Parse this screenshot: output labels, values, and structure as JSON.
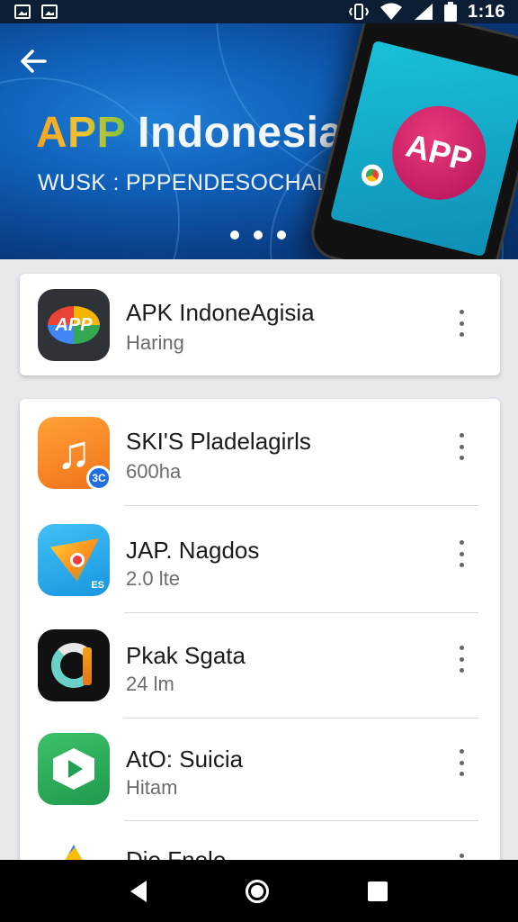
{
  "status_bar": {
    "time": "1:16",
    "left_icons": [
      "image-icon",
      "image-icon"
    ],
    "right_icons": [
      "vibrate-icon",
      "wifi-icon",
      "signal-icon",
      "battery-icon"
    ]
  },
  "hero": {
    "title_accent": "APP",
    "title_rest": " Indonesia",
    "subtitle": "WUSK : PPPENDESOCHAL",
    "phone_badge": "APP",
    "carousel_dots": 3,
    "colors": {
      "background": "#0f5fb8",
      "badge": "#d42168"
    }
  },
  "featured": {
    "name": "APK IndoneAgisia",
    "meta": "Haring"
  },
  "apps": [
    {
      "name": "SKI'S Pladelagirls",
      "meta": "600ha",
      "icon": "music-note-icon",
      "badge": "3C"
    },
    {
      "name": "JAP. Nagdos",
      "meta": "2.0 lte",
      "icon": "paper-plane-icon",
      "badge": "ES"
    },
    {
      "name": "Pkak Sgata",
      "meta": "24 lm",
      "icon": "c-letter-icon"
    },
    {
      "name": "AtO: Suicia",
      "meta": "Hitam",
      "icon": "play-icon"
    },
    {
      "name": "Dio Fnolo",
      "meta": "",
      "icon": "triangle-icon"
    }
  ],
  "nav": {
    "icons": [
      "back-icon",
      "home-icon",
      "recents-icon"
    ]
  }
}
